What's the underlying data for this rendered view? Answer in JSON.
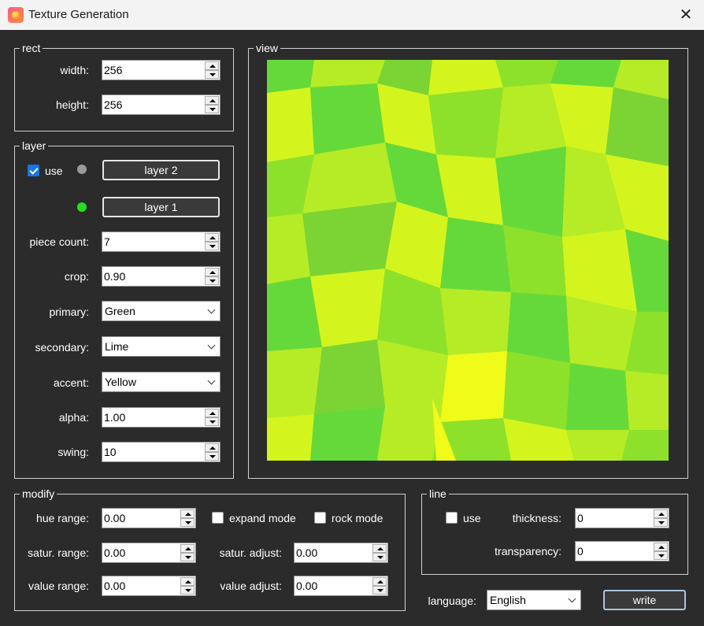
{
  "window": {
    "title": "Texture Generation"
  },
  "rect": {
    "title": "rect",
    "width_label": "width:",
    "width_value": "256",
    "height_label": "height:",
    "height_value": "256"
  },
  "layer": {
    "title": "layer",
    "use_label": "use",
    "use_checked": true,
    "layer2_label": "layer 2",
    "layer2_dot_color": "#9a9a9a",
    "layer1_label": "layer 1",
    "layer1_dot_color": "#22e022",
    "piece_count_label": "piece count:",
    "piece_count_value": "7",
    "crop_label": "crop:",
    "crop_value": "0.90",
    "primary_label": "primary:",
    "primary_value": "Green",
    "secondary_label": "secondary:",
    "secondary_value": "Lime",
    "accent_label": "accent:",
    "accent_value": "Yellow",
    "alpha_label": "alpha:",
    "alpha_value": "1.00",
    "swing_label": "swing:",
    "swing_value": "10"
  },
  "view": {
    "title": "view",
    "palette": [
      "#66d93a",
      "#8ee12b",
      "#b6ec26",
      "#d3f51d",
      "#f0fb1a",
      "#7bd433"
    ]
  },
  "modify": {
    "title": "modify",
    "hue_range_label": "hue range:",
    "hue_range_value": "0.00",
    "satur_range_label": "satur. range:",
    "satur_range_value": "0.00",
    "value_range_label": "value range:",
    "value_range_value": "0.00",
    "expand_mode_label": "expand mode",
    "rock_mode_label": "rock mode",
    "satur_adjust_label": "satur. adjust:",
    "satur_adjust_value": "0.00",
    "value_adjust_label": "value adjust:",
    "value_adjust_value": "0.00"
  },
  "line": {
    "title": "line",
    "use_label": "use",
    "thickness_label": "thickness:",
    "thickness_value": "0",
    "transparency_label": "transparency:",
    "transparency_value": "0"
  },
  "footer": {
    "language_label": "language:",
    "language_value": "English",
    "write_label": "write"
  }
}
